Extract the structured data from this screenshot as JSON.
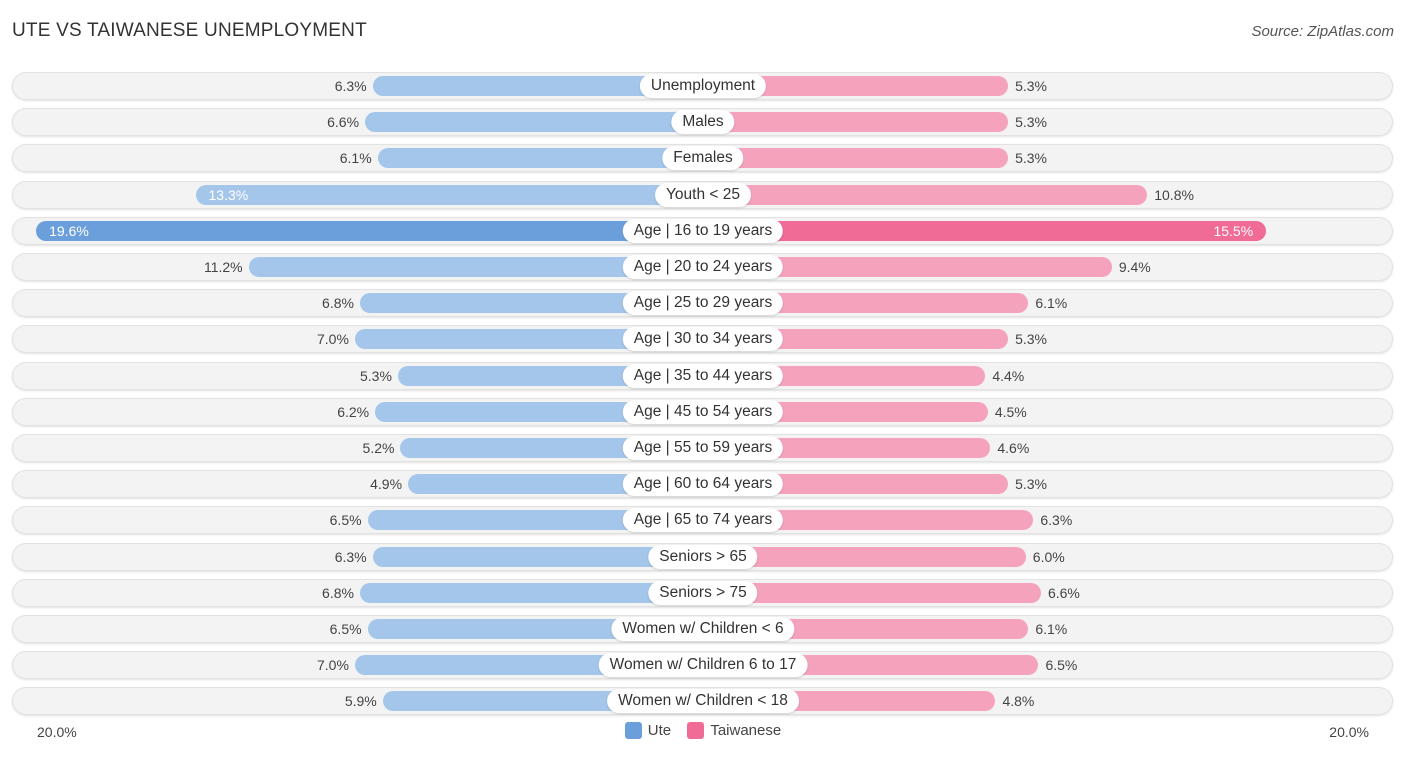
{
  "header": {
    "title": "UTE VS TAIWANESE UNEMPLOYMENT",
    "source": "Source: ZipAtlas.com"
  },
  "colors": {
    "ute": "#a4c6ea",
    "ute_highlight": "#6a9fdc",
    "taiwanese": "#f5a3bd",
    "taiwanese_highlight": "#f06b96",
    "row_background": "#f3f3f3"
  },
  "chart_data": {
    "type": "bar",
    "orientation": "horizontal-diverging",
    "title": "UTE VS TAIWANESE UNEMPLOYMENT",
    "categories": [
      "Unemployment",
      "Males",
      "Females",
      "Youth < 25",
      "Age | 16 to 19 years",
      "Age | 20 to 24 years",
      "Age | 25 to 29 years",
      "Age | 30 to 34 years",
      "Age | 35 to 44 years",
      "Age | 45 to 54 years",
      "Age | 55 to 59 years",
      "Age | 60 to 64 years",
      "Age | 65 to 74 years",
      "Seniors > 65",
      "Seniors > 75",
      "Women w/ Children < 6",
      "Women w/ Children 6 to 17",
      "Women w/ Children < 18"
    ],
    "series": [
      {
        "name": "Ute",
        "side": "left",
        "values": [
          6.3,
          6.6,
          6.1,
          13.3,
          19.6,
          11.2,
          6.8,
          7.0,
          5.3,
          6.2,
          5.2,
          4.9,
          6.5,
          6.3,
          6.8,
          6.5,
          7.0,
          5.9
        ],
        "labels": [
          "6.3%",
          "6.6%",
          "6.1%",
          "13.3%",
          "19.6%",
          "11.2%",
          "6.8%",
          "7.0%",
          "5.3%",
          "6.2%",
          "5.2%",
          "4.9%",
          "6.5%",
          "6.3%",
          "6.8%",
          "6.5%",
          "7.0%",
          "5.9%"
        ]
      },
      {
        "name": "Taiwanese",
        "side": "right",
        "values": [
          5.3,
          5.3,
          5.3,
          10.8,
          15.5,
          9.4,
          6.1,
          5.3,
          4.4,
          4.5,
          4.6,
          5.3,
          6.3,
          6.0,
          6.6,
          6.1,
          6.5,
          4.8
        ],
        "labels": [
          "5.3%",
          "5.3%",
          "5.3%",
          "10.8%",
          "15.5%",
          "9.4%",
          "6.1%",
          "5.3%",
          "4.4%",
          "4.5%",
          "4.6%",
          "5.3%",
          "6.3%",
          "6.0%",
          "6.6%",
          "6.1%",
          "6.5%",
          "4.8%"
        ]
      }
    ],
    "axis": {
      "left_label": "20.0%",
      "right_label": "20.0%",
      "max": 20.0,
      "unit": "%"
    },
    "legend": {
      "placement": "bottom-center",
      "entries": [
        "Ute",
        "Taiwanese"
      ]
    },
    "grid": false
  }
}
